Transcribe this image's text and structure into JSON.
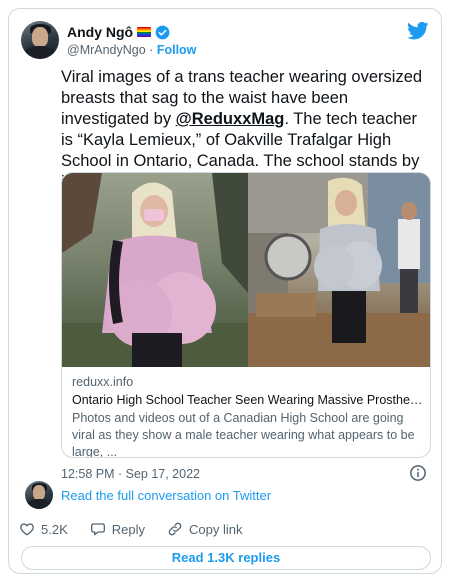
{
  "author": {
    "name": "Andy Ngô",
    "handle": "@MrAndyNgo",
    "separator": "·",
    "follow_label": "Follow"
  },
  "tweet": {
    "text_before": "Viral images of a trans teacher wearing oversized breasts that sag to the waist have been investigated by ",
    "mention": "@ReduxxMag",
    "text_after": ". The tech teacher is “Kayla Lemieux,” of Oakville Trafalgar High School in Ontario, Canada. The school stands by its teacher."
  },
  "link_card": {
    "domain": "reduxx.info",
    "title": "Ontario High School Teacher Seen Wearing Massive Prosthetic B...",
    "description": "Photos and videos out of a Canadian High School are going viral as they show a male teacher wearing what appears to be large, ..."
  },
  "timestamp": "12:58 PM · Sep 17, 2022",
  "thread": {
    "read_label": "Read the full conversation on Twitter"
  },
  "actions": {
    "like_count": "5.2K",
    "reply_label": "Reply",
    "copy_label": "Copy link"
  },
  "replies_button": "Read 1.3K replies",
  "colors": {
    "accent": "#1d9bf0",
    "text": "#0f1419",
    "muted": "#536471",
    "border": "#cfd9de"
  },
  "icons": {
    "brand": "twitter-bird-icon",
    "verified": "verified-badge-icon",
    "flag": "rainbow-flag-icon",
    "info": "info-icon",
    "like": "heart-icon",
    "reply": "reply-bubble-icon",
    "copy": "link-icon"
  }
}
